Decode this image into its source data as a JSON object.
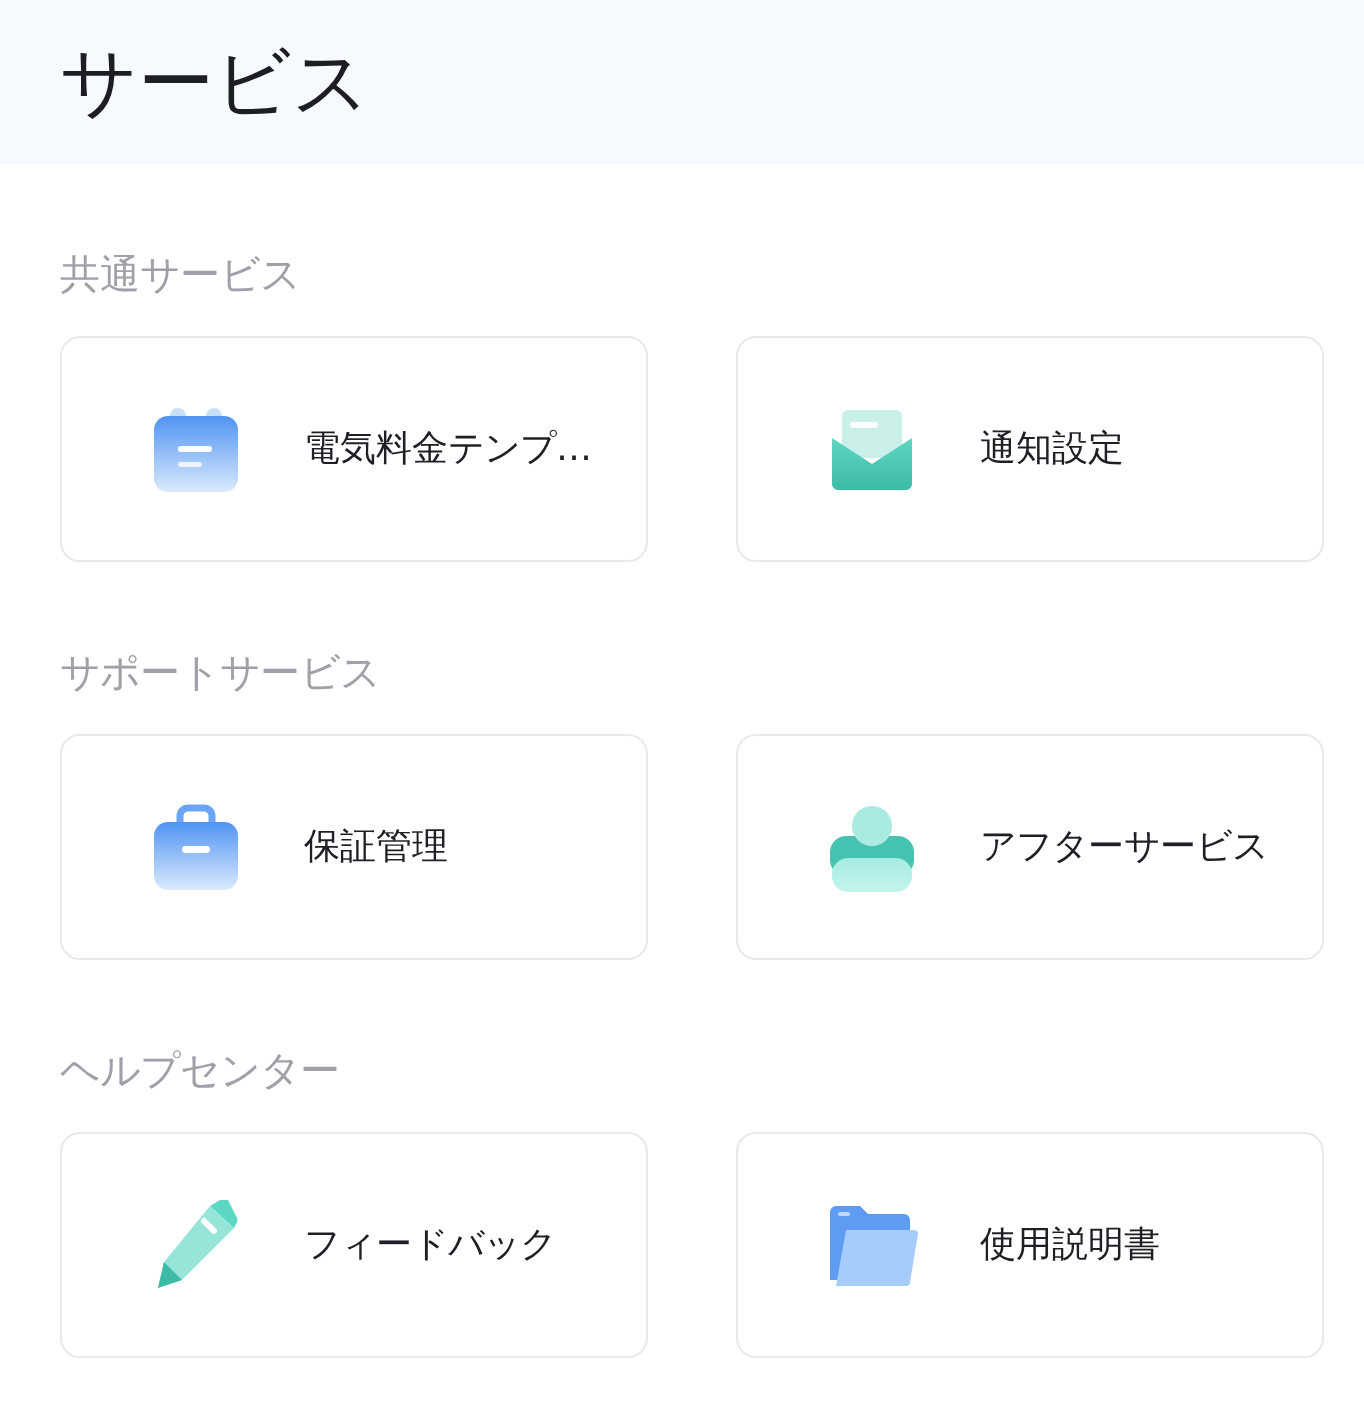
{
  "header": {
    "title": "サービス"
  },
  "sections": [
    {
      "title": "共通サービス",
      "items": [
        {
          "label": "電気料金テンプ…",
          "kind": "calendar"
        },
        {
          "label": "通知設定",
          "kind": "inbox"
        }
      ]
    },
    {
      "title": "サポートサービス",
      "items": [
        {
          "label": "保証管理",
          "kind": "briefcase"
        },
        {
          "label": "アフターサービス",
          "kind": "person"
        }
      ]
    },
    {
      "title": "ヘルプセンター",
      "items": [
        {
          "label": "フィードバック",
          "kind": "pencil"
        },
        {
          "label": "使用説明書",
          "kind": "folder"
        }
      ]
    }
  ]
}
